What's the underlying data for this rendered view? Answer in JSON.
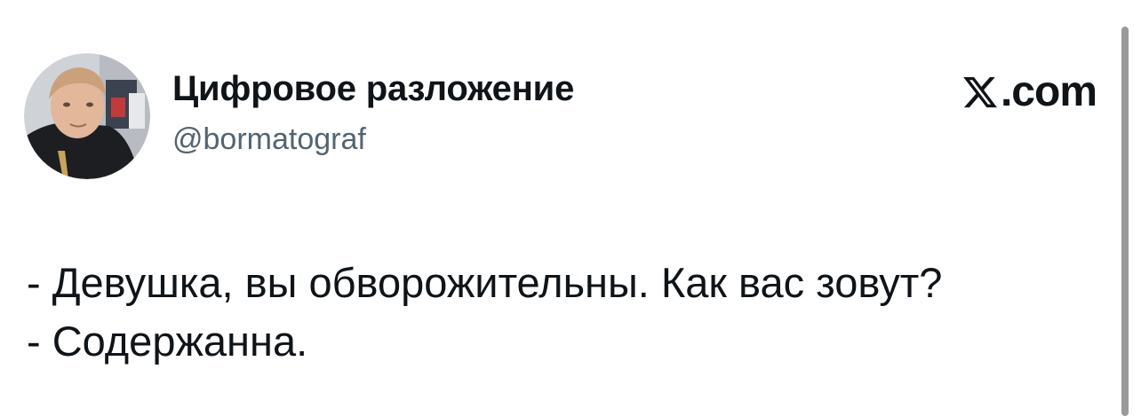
{
  "author": {
    "display_name": "Цифровое разложение",
    "handle": "@bormatograf",
    "avatar_icon": "profile-photo"
  },
  "brand": {
    "text": ".com",
    "icon": "x-logo-icon"
  },
  "tweet": {
    "lines": [
      "- Девушка, вы обворожительны. Как вас зовут?",
      "- Содержанна."
    ]
  },
  "colors": {
    "text": "#0f1419",
    "secondary": "#536471",
    "scrollbar": "#9a9a9a",
    "background": "#ffffff"
  }
}
